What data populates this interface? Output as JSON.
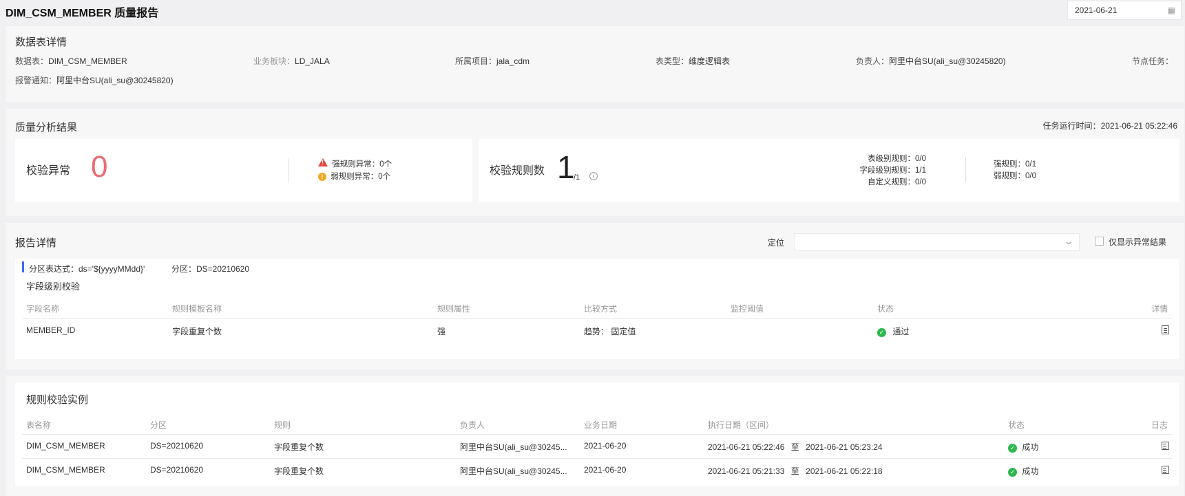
{
  "header": {
    "title": "DIM_CSM_MEMBER 质量报告",
    "date": "2021-06-21"
  },
  "table_detail": {
    "title": "数据表详情",
    "fields": [
      {
        "label": "数据表：",
        "value": "DIM_CSM_MEMBER"
      },
      {
        "label": "业务板块：",
        "value": "LD_JALA"
      },
      {
        "label": "所属项目：",
        "value": "jala_cdm"
      },
      {
        "label": "表类型：",
        "value": "维度逻辑表"
      },
      {
        "label": "负责人：",
        "value": "阿里中台SU(ali_su@30245820)"
      },
      {
        "label": "节点任务：",
        "value": ""
      },
      {
        "label": "报警通知：",
        "value": "阿里中台SU(ali_su@30245820)"
      }
    ]
  },
  "quality": {
    "title": "质量分析结果",
    "run_time_label": "任务运行时间：",
    "run_time": "2021-06-21 05:22:46",
    "abnormal_label": "校验异常",
    "abnormal_count": "0",
    "strong_abnormal": "强规则异常：0个",
    "weak_abnormal": "弱规则异常：0个",
    "rules_label": "校验规则数",
    "rules_count": "1",
    "rules_total": "/1",
    "table_rules": "表级别规则：0/0",
    "field_rules": "字段级别规则：1/1",
    "custom_rules": "自定义规则：0/0",
    "strong_rules": "强规则：0/1",
    "weak_rules": "弱规则：0/0"
  },
  "report": {
    "title": "报告详情",
    "locate_label": "定位",
    "locate_value": "",
    "only_abnormal_label": "仅显示异常结果",
    "partition_expr": "分区表达式：ds='${yyyyMMdd}'",
    "partition": "分区：DS=20210620",
    "field_check_title": "字段级别校验",
    "columns": [
      "字段名称",
      "规则模板名称",
      "规则属性",
      "比较方式",
      "监控阈值",
      "状态",
      "详情"
    ],
    "rows": [
      {
        "field": "MEMBER_ID",
        "template": "字段重复个数",
        "attr": "强",
        "compare": "趋势： 固定值",
        "threshold": "",
        "status": "通过"
      }
    ]
  },
  "instances": {
    "title": "规则校验实例",
    "columns": [
      "表名称",
      "分区",
      "规则",
      "负责人",
      "业务日期",
      "执行日期（区间）",
      "状态",
      "日志"
    ],
    "rows": [
      {
        "table": "DIM_CSM_MEMBER",
        "partition": "DS=20210620",
        "rule": "字段重复个数",
        "owner": "阿里中台SU(ali_su@30245...",
        "biz_date": "2021-06-20",
        "exec_start": "2021-06-21 05:22:46",
        "to": "至",
        "exec_end": "2021-06-21 05:23:24",
        "status": "成功"
      },
      {
        "table": "DIM_CSM_MEMBER",
        "partition": "DS=20210620",
        "rule": "字段重复个数",
        "owner": "阿里中台SU(ali_su@30245...",
        "biz_date": "2021-06-20",
        "exec_start": "2021-06-21 05:21:33",
        "to": "至",
        "exec_end": "2021-06-21 05:22:18",
        "status": "成功"
      }
    ]
  },
  "colors": {
    "accent": "#3b6cf5",
    "abnormal_zero": "#ee6a73",
    "success": "#2db84d",
    "warning": "#f5a623",
    "danger": "#e8423f"
  }
}
